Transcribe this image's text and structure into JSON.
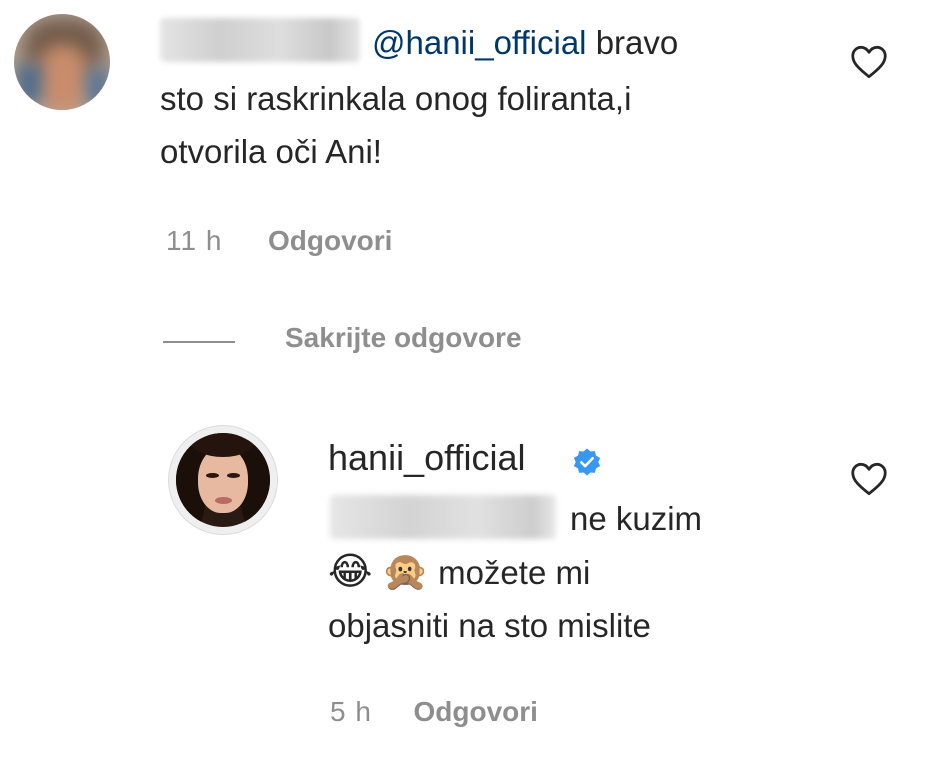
{
  "comment": {
    "username_visible": false,
    "mention": "@hanii_official",
    "text_line1": "bravo",
    "text_line2": "sto si raskrinkala onog foliranta,i",
    "text_line3": "otvorila oči Ani!",
    "time": "11 h",
    "reply_label": "Odgovori",
    "like_icon": "heart-outline-icon"
  },
  "replies": {
    "toggle_label": "Sakrijte odgovore"
  },
  "reply": {
    "username": "hanii_official",
    "verified_icon": "verified-badge-icon",
    "text_line1": "ne kuzim",
    "emoji1": "😂",
    "emoji2": "🙊",
    "text_line2": "možete mi",
    "text_line3": "objasniti na sto mislite",
    "time": "5 h",
    "reply_label": "Odgovori",
    "like_icon": "heart-outline-icon"
  },
  "colors": {
    "text": "#262626",
    "secondary": "#8e8e8e",
    "mention": "#00376b",
    "verified": "#3897f0"
  }
}
